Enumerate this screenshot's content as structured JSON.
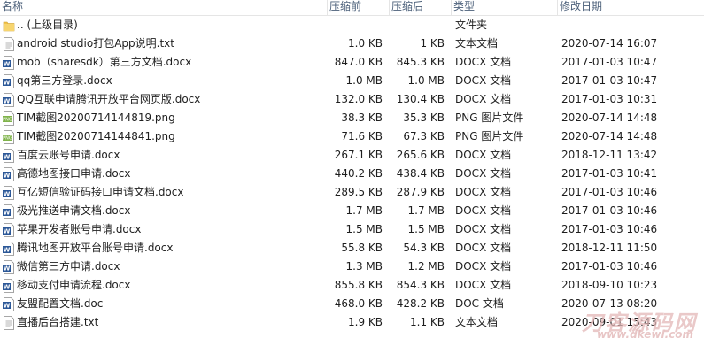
{
  "columns": {
    "name": "名称",
    "size_before": "压缩前",
    "size_after": "压缩后",
    "type": "类型",
    "modified": "修改日期"
  },
  "files": [
    {
      "icon": "folder-up-icon",
      "name": ".. (上级目录)",
      "before": "",
      "after": "",
      "type": "文件夹",
      "date": ""
    },
    {
      "icon": "text-file-icon",
      "name": "android studio打包App说明.txt",
      "before": "1.0 KB",
      "after": "1 KB",
      "type": "文本文档",
      "date": "2020-07-14 16:07"
    },
    {
      "icon": "docx-file-icon",
      "name": "mob（sharesdk）第三方文档.docx",
      "before": "847.0 KB",
      "after": "845.3 KB",
      "type": "DOCX 文档",
      "date": "2017-01-03 10:47"
    },
    {
      "icon": "docx-file-icon",
      "name": "qq第三方登录.docx",
      "before": "1.0 MB",
      "after": "1.0 MB",
      "type": "DOCX 文档",
      "date": "2017-01-03 10:47"
    },
    {
      "icon": "docx-file-icon",
      "name": "QQ互联申请腾讯开放平台网页版.docx",
      "before": "132.0 KB",
      "after": "130.4 KB",
      "type": "DOCX 文档",
      "date": "2017-01-03 10:31"
    },
    {
      "icon": "png-file-icon",
      "name": "TIM截图20200714144819.png",
      "before": "38.3 KB",
      "after": "35.3 KB",
      "type": "PNG 图片文件",
      "date": "2020-07-14 14:48"
    },
    {
      "icon": "png-file-icon",
      "name": "TIM截图20200714144841.png",
      "before": "71.6 KB",
      "after": "67.3 KB",
      "type": "PNG 图片文件",
      "date": "2020-07-14 14:48"
    },
    {
      "icon": "docx-file-icon",
      "name": "百度云账号申请.docx",
      "before": "267.1 KB",
      "after": "265.6 KB",
      "type": "DOCX 文档",
      "date": "2018-12-11 13:42"
    },
    {
      "icon": "docx-file-icon",
      "name": "高德地图接口申请.docx",
      "before": "440.2 KB",
      "after": "438.4 KB",
      "type": "DOCX 文档",
      "date": "2017-01-03 10:41"
    },
    {
      "icon": "docx-file-icon",
      "name": "互亿短信验证码接口申请文档.docx",
      "before": "289.5 KB",
      "after": "287.9 KB",
      "type": "DOCX 文档",
      "date": "2017-01-03 10:46"
    },
    {
      "icon": "docx-file-icon",
      "name": "极光推送申请文档.docx",
      "before": "1.7 MB",
      "after": "1.7 MB",
      "type": "DOCX 文档",
      "date": "2017-01-03 10:46"
    },
    {
      "icon": "docx-file-icon",
      "name": "苹果开发者账号申请.docx",
      "before": "1.5 MB",
      "after": "1.5 MB",
      "type": "DOCX 文档",
      "date": "2017-01-03 10:46"
    },
    {
      "icon": "docx-file-icon",
      "name": "腾讯地图开放平台账号申请.docx",
      "before": "55.8 KB",
      "after": "54.3 KB",
      "type": "DOCX 文档",
      "date": "2018-12-11 11:50"
    },
    {
      "icon": "docx-file-icon",
      "name": "微信第三方申请.docx",
      "before": "1.3 MB",
      "after": "1.2 MB",
      "type": "DOCX 文档",
      "date": "2017-01-03 10:46"
    },
    {
      "icon": "docx-file-icon",
      "name": "移动支付申请流程.docx",
      "before": "855.8 KB",
      "after": "854.3 KB",
      "type": "DOCX 文档",
      "date": "2018-09-10 10:23"
    },
    {
      "icon": "doc-file-icon",
      "name": "友盟配置文档.doc",
      "before": "468.0 KB",
      "after": "428.2 KB",
      "type": "DOC 文档",
      "date": "2020-07-13 08:20"
    },
    {
      "icon": "text-file-icon",
      "name": "直播后台搭建.txt",
      "before": "1.9 KB",
      "after": "1.1 KB",
      "type": "文本文档",
      "date": "2020-09-01 15:43"
    }
  ],
  "watermark": {
    "line1": "刀客源码网",
    "line2": "www.dkewl.com"
  },
  "colors": {
    "header_text": "#4c607a",
    "folder": "#f0c24b",
    "word_blue": "#2b5797",
    "png_green": "#7fb34a",
    "watermark": "#e3b8b8"
  }
}
